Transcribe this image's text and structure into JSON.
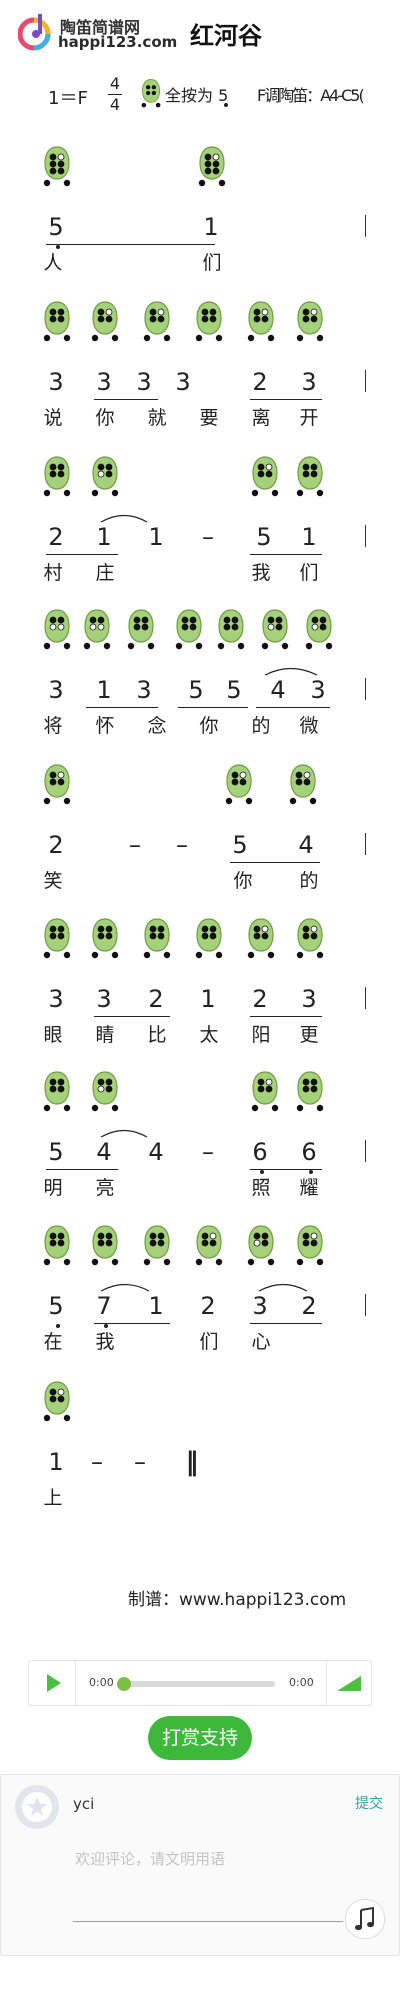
{
  "header": {
    "site_name": "陶笛简谱网",
    "site_url": "happi123.com",
    "song_title": "红河谷"
  },
  "meta": {
    "key": "1＝F",
    "time_top": "4",
    "time_bottom": "4",
    "fingering_prefix": "全按为",
    "fingering_note": "5",
    "range_text": "F调陶笛：A4-C5("
  },
  "icons": {
    "ocarina": "ocarina-fingering-icon",
    "play": "play-icon",
    "volume": "volume-icon",
    "avatar": "star-avatar-icon",
    "music": "music-note-icon"
  },
  "colors": {
    "ocarina_body": "#a5d17a",
    "ocarina_stroke": "#6e9b43",
    "accent_green": "#3db83a",
    "submit_teal": "#2aa6a0"
  },
  "score": [
    {
      "notes": [
        "5",
        "1"
      ],
      "lyrics": [
        "人",
        "们"
      ],
      "bar": true
    },
    {
      "notes": [
        "3",
        "3",
        "3",
        "3",
        "2",
        "3"
      ],
      "lyrics": [
        "说",
        "你",
        "就",
        "要",
        "离",
        "开"
      ],
      "bar": true
    },
    {
      "notes": [
        "2",
        "1",
        "1",
        "–",
        "5",
        "1"
      ],
      "lyrics": [
        "村",
        "庄",
        "",
        "",
        "我",
        "们"
      ],
      "bar": true
    },
    {
      "notes": [
        "3",
        "1",
        "3",
        "5",
        "5",
        "4",
        "3"
      ],
      "lyrics": [
        "将",
        "怀",
        "念",
        "你",
        "的",
        "微"
      ],
      "bar": true
    },
    {
      "notes": [
        "2",
        "–",
        "–",
        "5",
        "4"
      ],
      "lyrics": [
        "笑",
        "",
        "",
        "你",
        "的"
      ],
      "bar": true
    },
    {
      "notes": [
        "3",
        "3",
        "2",
        "1",
        "2",
        "3"
      ],
      "lyrics": [
        "眼",
        "睛",
        "比",
        "太",
        "阳",
        "更"
      ],
      "bar": true
    },
    {
      "notes": [
        "5",
        "4",
        "4",
        "–",
        "6",
        "6"
      ],
      "lyrics": [
        "明",
        "亮",
        "",
        "",
        "照",
        "耀"
      ],
      "bar": true
    },
    {
      "notes": [
        "5",
        "7",
        "1",
        "2",
        "3",
        "2"
      ],
      "lyrics": [
        "在",
        "我",
        "",
        "们",
        "心",
        ""
      ],
      "bar": true
    },
    {
      "notes": [
        "1",
        "–",
        "–",
        "‖"
      ],
      "lyrics": [
        "上"
      ],
      "bar": false
    }
  ],
  "footer": {
    "maker_label": "制谱：www.happi123.com"
  },
  "player": {
    "current_time": "0:00",
    "total_time": "0:00",
    "progress": 0
  },
  "tip_button": "打赏支持",
  "comment": {
    "user_name": "yci",
    "submit_label": "提交",
    "placeholder": "欢迎评论，请文明用语"
  }
}
